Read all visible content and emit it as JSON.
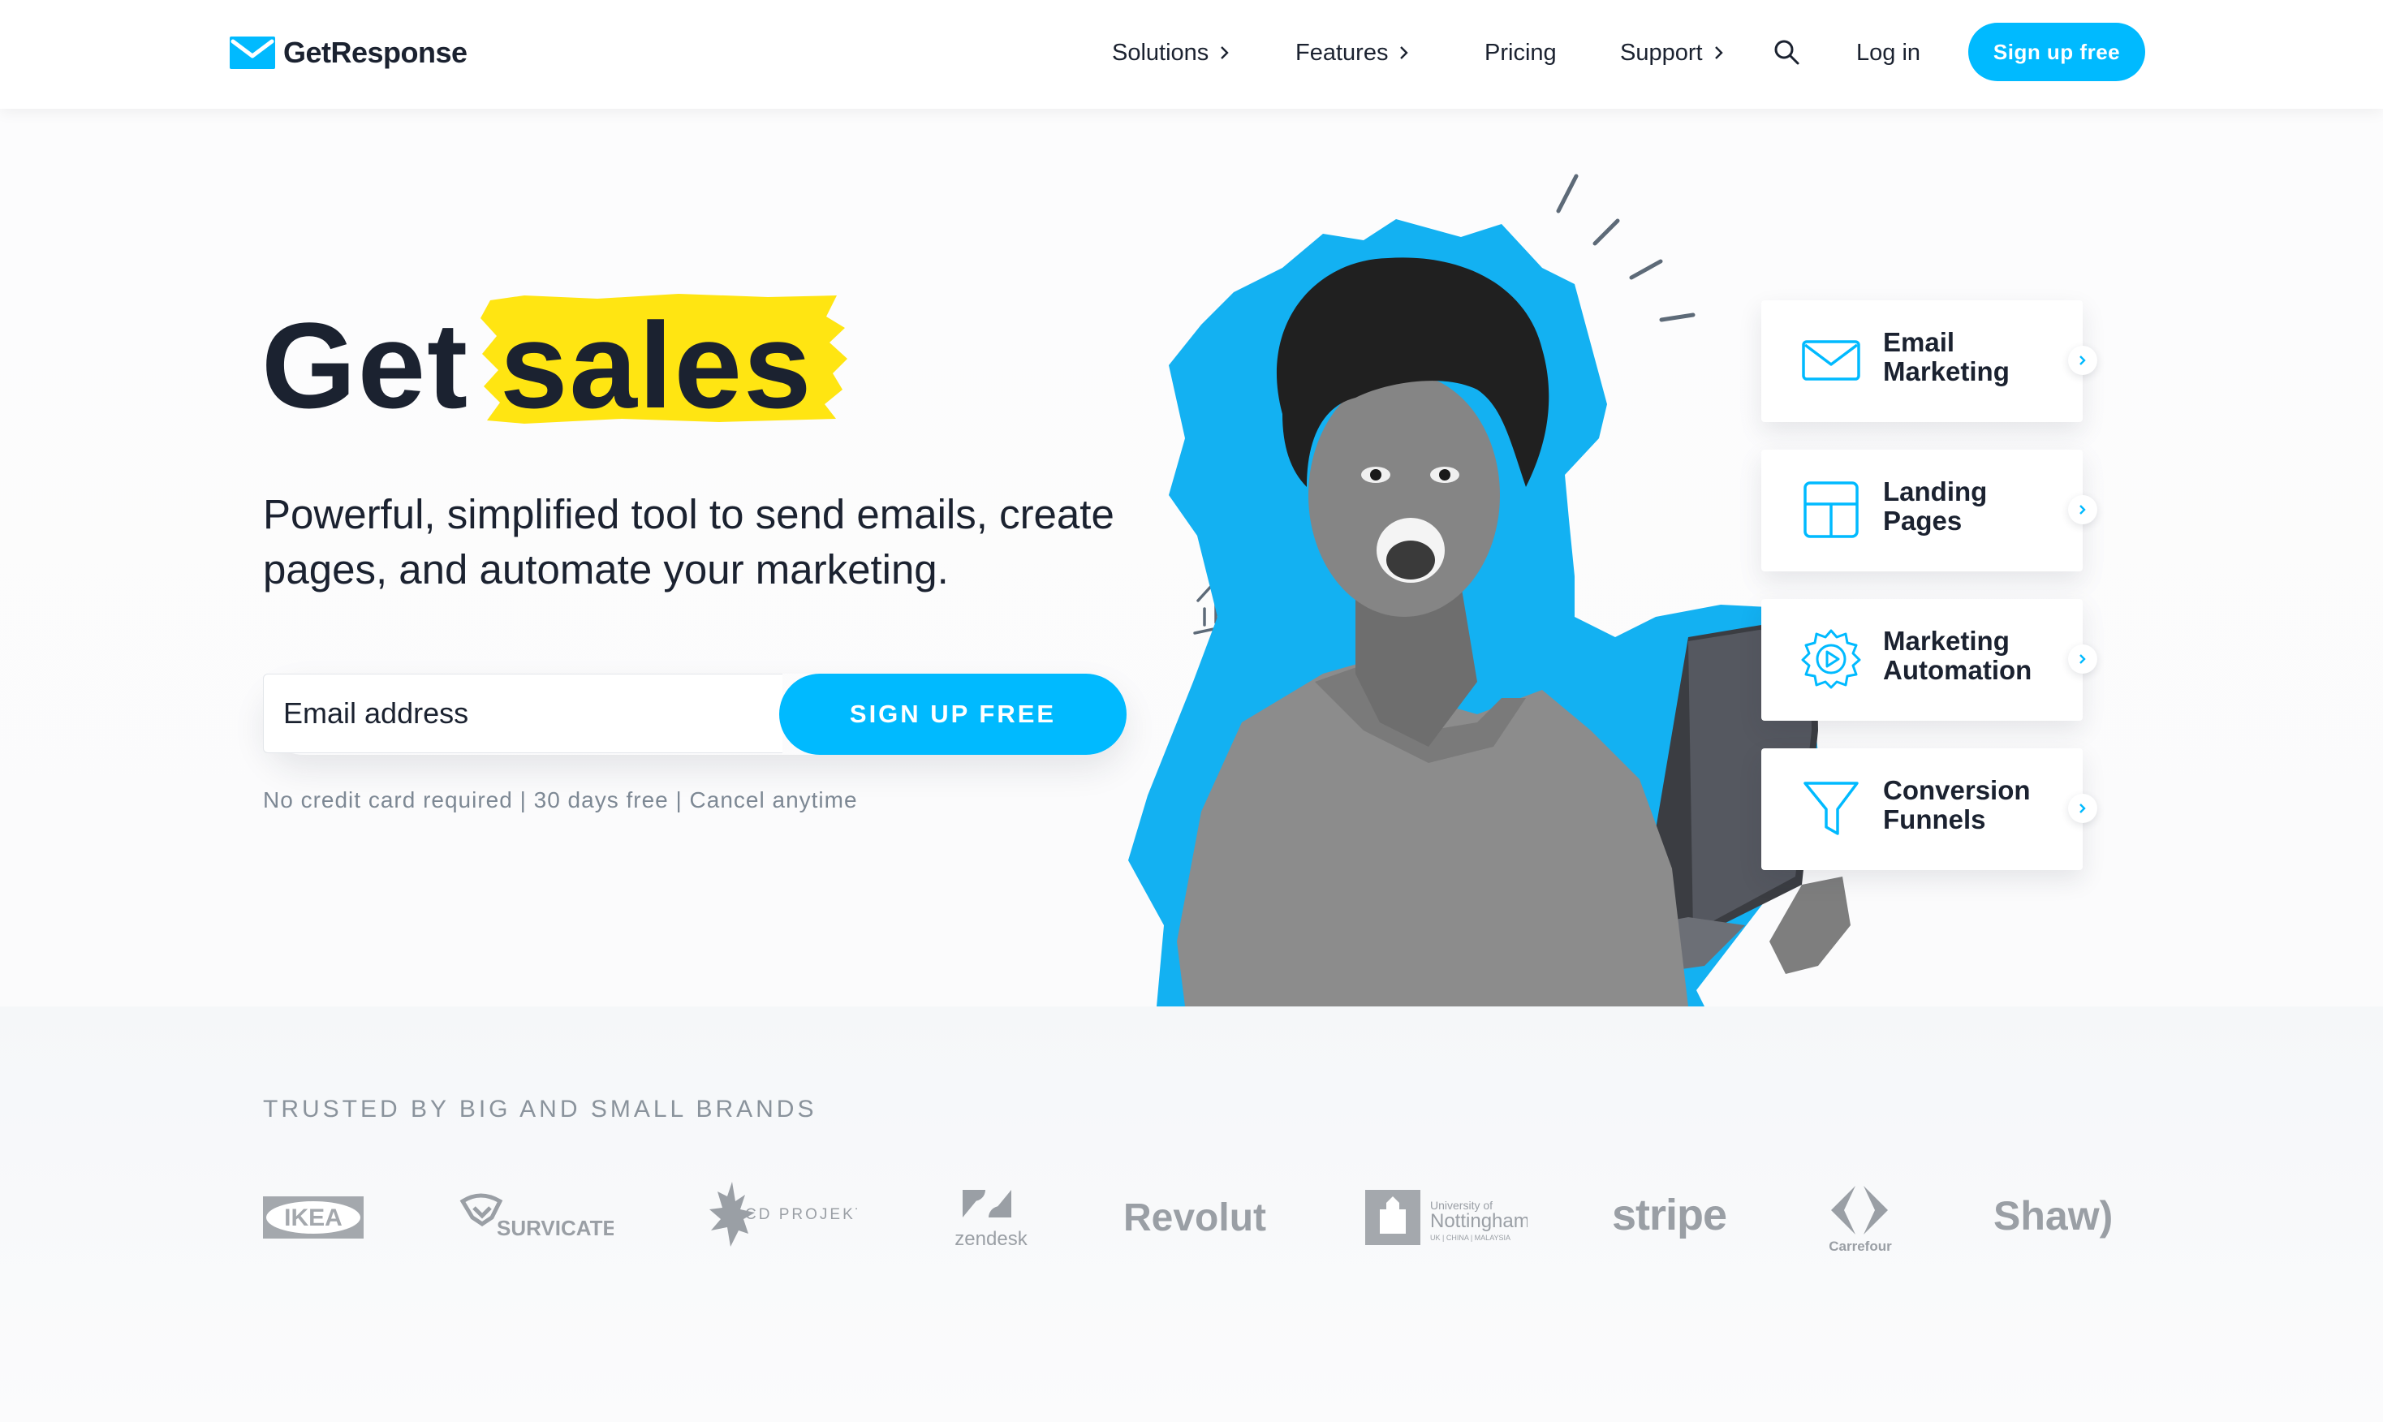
{
  "header": {
    "logo_text": "GetResponse",
    "nav": [
      {
        "label": "Solutions",
        "has_chevron": true
      },
      {
        "label": "Features",
        "has_chevron": true
      },
      {
        "label": "Pricing",
        "has_chevron": false
      },
      {
        "label": "Support",
        "has_chevron": true
      }
    ],
    "login_label": "Log in",
    "signup_label": "Sign up free"
  },
  "hero": {
    "headline_word1": "Get",
    "headline_word2": "sales",
    "subtitle": "Powerful, simplified tool to send emails, create pages, and automate your marketing.",
    "email_placeholder": "Email address",
    "signup_button": "SIGN UP FREE",
    "disclaimer": "No credit card required | 30 days free | Cancel anytime"
  },
  "features": [
    {
      "label": "Email Marketing",
      "icon": "envelope-icon"
    },
    {
      "label": "Landing Pages",
      "icon": "layout-icon"
    },
    {
      "label": "Marketing Automation",
      "icon": "gear-play-icon"
    },
    {
      "label": "Conversion Funnels",
      "icon": "funnel-icon"
    }
  ],
  "brands": {
    "title": "TRUSTED BY BIG AND SMALL BRANDS",
    "logos": [
      "IKEA",
      "SURVICATE",
      "CD PROJEKT",
      "zendesk",
      "Revolut",
      "University of",
      "Nottingham",
      "UK | CHINA | MALAYSIA",
      "stripe",
      "Carrefour",
      "Shaw)"
    ]
  },
  "colors": {
    "accent": "#00baff",
    "highlight": "#ffe512",
    "text": "#1b2230",
    "muted": "#7d8894"
  }
}
